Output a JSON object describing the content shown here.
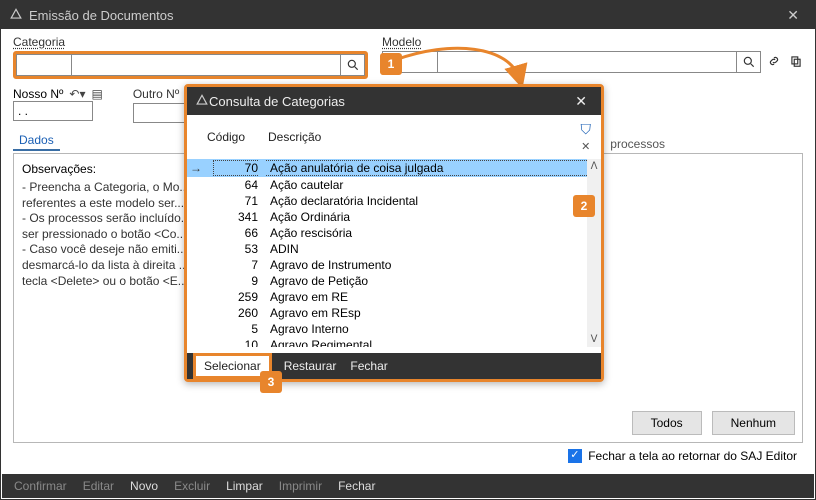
{
  "main": {
    "title": "Emissão de Documentos",
    "categoria_label": "Categoria",
    "modelo_label": "Modelo",
    "nossoNo_label": "Nosso Nº",
    "outroNo_label": "Outro Nº",
    "nossoNo_value": ". .",
    "tab_dados": "Dados",
    "obs_title": "Observações:",
    "obs_lines": [
      "- Preencha a Categoria, o Mo...",
      "referentes a este modelo ser...",
      "- Os processos serão incluído...",
      "ser pressionado o botão <Co...",
      "- Caso você deseje não emiti...",
      "desmarcá-lo da lista à direita ...",
      "tecla <Delete> ou o botão <E..."
    ],
    "side_processos": "processos",
    "btn_todos": "Todos",
    "btn_nenhum": "Nenhum",
    "check_fechar": "Fechar a tela ao retornar do SAJ Editor"
  },
  "bottom": {
    "confirmar": "Confirmar",
    "editar": "Editar",
    "novo": "Novo",
    "excluir": "Excluir",
    "limpar": "Limpar",
    "imprimir": "Imprimir",
    "fechar": "Fechar"
  },
  "dialog": {
    "title": "Consulta de Categorias",
    "col_codigo": "Código",
    "col_descricao": "Descrição",
    "rows": [
      {
        "codigo": "70",
        "desc": "Ação anulatória de coisa julgada"
      },
      {
        "codigo": "64",
        "desc": "Ação cautelar"
      },
      {
        "codigo": "71",
        "desc": "Ação declaratória Incidental"
      },
      {
        "codigo": "341",
        "desc": "Ação Ordinária"
      },
      {
        "codigo": "66",
        "desc": "Ação rescisória"
      },
      {
        "codigo": "53",
        "desc": "ADIN"
      },
      {
        "codigo": "7",
        "desc": "Agravo de Instrumento"
      },
      {
        "codigo": "9",
        "desc": "Agravo de Petição"
      },
      {
        "codigo": "259",
        "desc": "Agravo em RE"
      },
      {
        "codigo": "260",
        "desc": "Agravo em REsp"
      },
      {
        "codigo": "5",
        "desc": "Agravo Interno"
      },
      {
        "codigo": "10",
        "desc": "Agravo Regimental"
      }
    ],
    "btn_selecionar": "Selecionar",
    "btn_restaurar": "staurar",
    "btn_fechar": "Fechar"
  },
  "callouts": {
    "c1": "1",
    "c2": "2",
    "c3": "3"
  }
}
